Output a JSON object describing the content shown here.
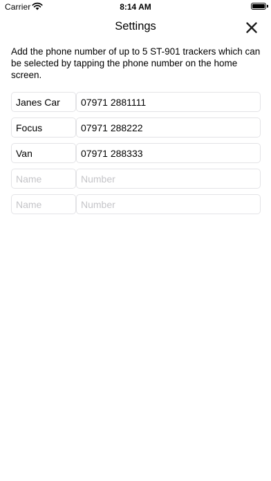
{
  "status_bar": {
    "carrier": "Carrier",
    "time": "8:14 AM",
    "battery_level": 1.0
  },
  "nav": {
    "title": "Settings",
    "close_icon": "close-icon"
  },
  "description": "Add the phone number of up to 5 ST-901 trackers which can be selected by tapping the phone number on the home screen.",
  "trackers": [
    {
      "name": "Janes Car",
      "number": "07971 2881111",
      "name_placeholder": "Name",
      "number_placeholder": "Number"
    },
    {
      "name": "Focus",
      "number": "07971 288222",
      "name_placeholder": "Name",
      "number_placeholder": "Number"
    },
    {
      "name": "Van",
      "number": "07971 288333",
      "name_placeholder": "Name",
      "number_placeholder": "Number"
    },
    {
      "name": "",
      "number": "",
      "name_placeholder": "Name",
      "number_placeholder": "Number"
    },
    {
      "name": "",
      "number": "",
      "name_placeholder": "Name",
      "number_placeholder": "Number"
    }
  ],
  "colors": {
    "field_border": "#e3e3e6",
    "placeholder": "#c4c4c8"
  }
}
